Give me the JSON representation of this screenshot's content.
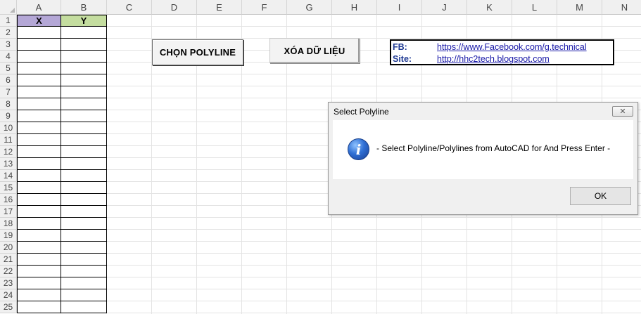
{
  "sheet": {
    "columns": [
      "A",
      "B",
      "C",
      "D",
      "E",
      "F",
      "G",
      "H",
      "I",
      "J",
      "K",
      "L",
      "M",
      "N"
    ],
    "rows": [
      "1",
      "2",
      "3",
      "4",
      "5",
      "6",
      "7",
      "8",
      "9",
      "10",
      "11",
      "12",
      "13",
      "14",
      "15",
      "16",
      "17",
      "18",
      "19",
      "20",
      "21",
      "22",
      "23",
      "24",
      "25"
    ],
    "header_x": "X",
    "header_y": "Y",
    "header_x_color": "#b4a7d6",
    "header_y_color": "#c4dd9f"
  },
  "buttons": {
    "select_polyline": "CHỌN POLYLINE",
    "clear_data": "XÓA DỮ LIỆU"
  },
  "info": {
    "fb_label": "FB:",
    "fb_link": "https://www.Facebook.com/g.technical",
    "site_label": "Site:",
    "site_link": "http://hhc2tech.blogspot.com"
  },
  "dialog": {
    "title": "Select  Polyline",
    "close_glyph": "✕",
    "icon_glyph": "i",
    "message": "- Select Polyline/Polylines from AutoCAD for And Press Enter -",
    "ok_label": "OK"
  }
}
